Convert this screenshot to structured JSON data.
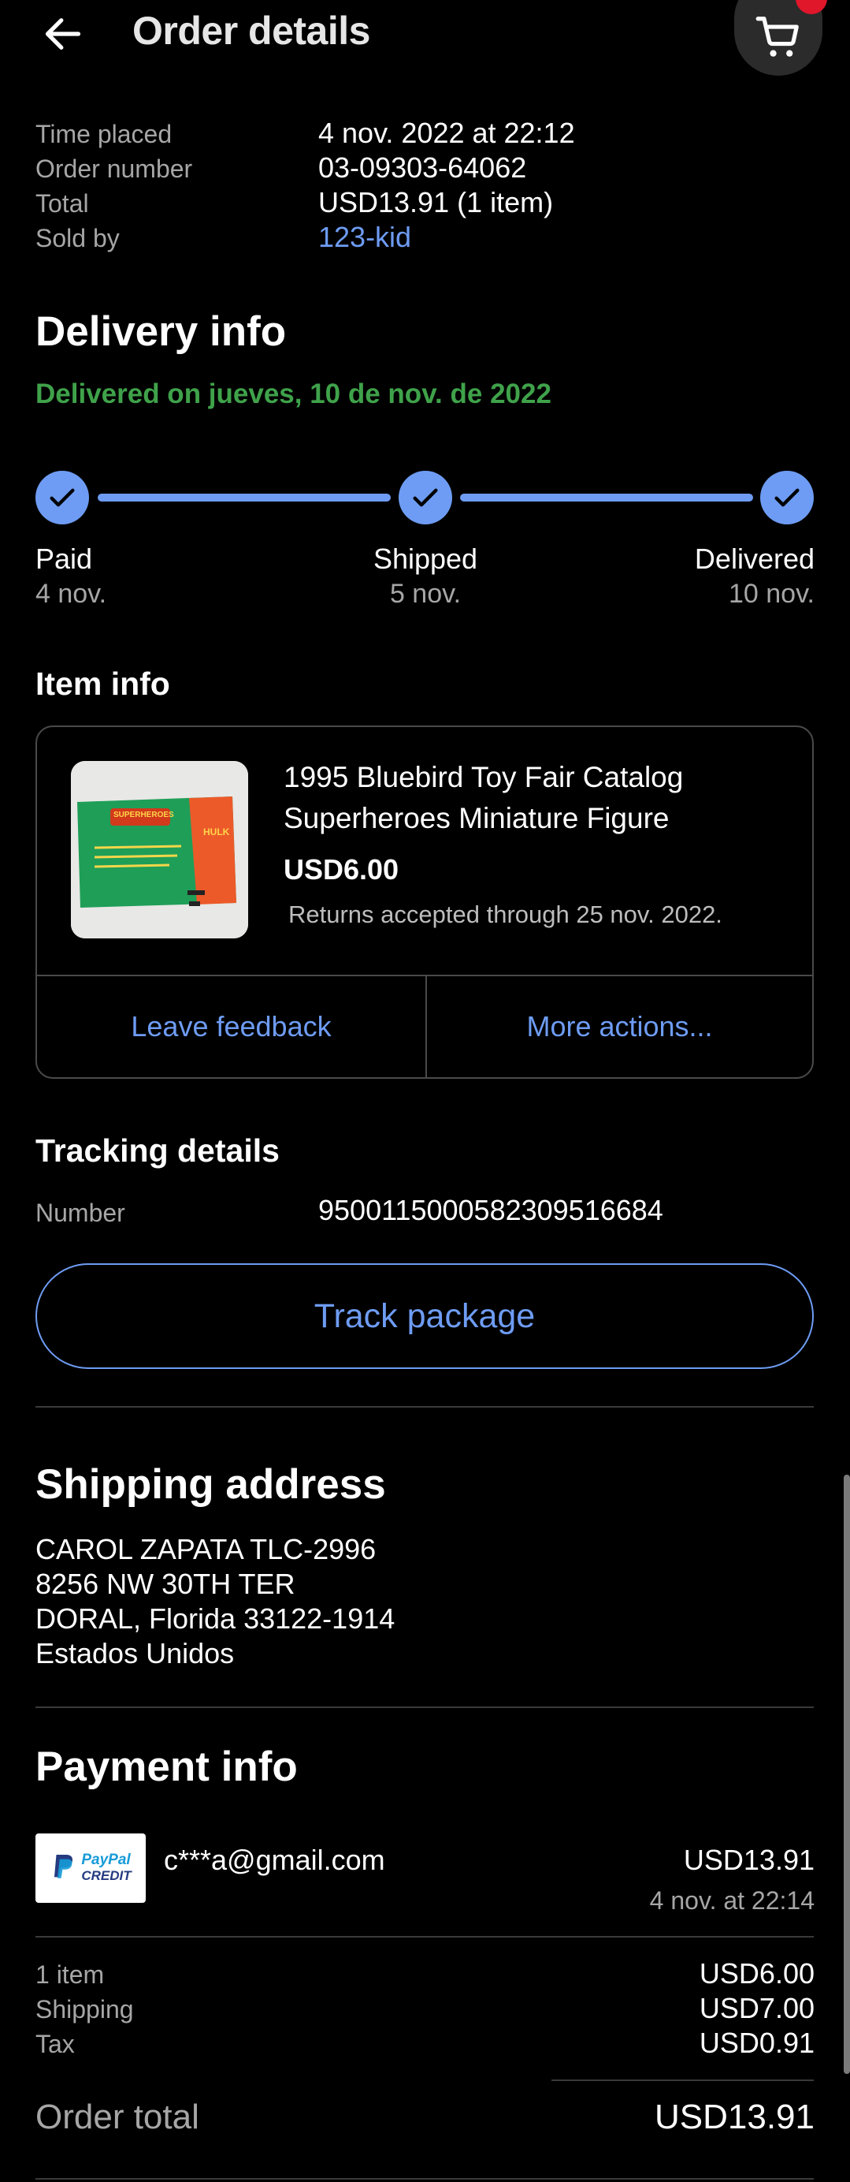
{
  "header": {
    "title": "Order details",
    "back_icon": "arrow-left-icon",
    "cart_icon": "cart-icon"
  },
  "summary": {
    "time_placed_label": "Time placed",
    "time_placed_value": "4 nov. 2022 at 22:12",
    "order_number_label": "Order number",
    "order_number_value": "03-09303-64062",
    "total_label": "Total",
    "total_value": "USD13.91 (1 item)",
    "sold_by_label": "Sold by",
    "sold_by_value": "123-kid"
  },
  "delivery": {
    "title": "Delivery info",
    "status": "Delivered on jueves, 10 de nov. de 2022",
    "steps": [
      {
        "label": "Paid",
        "date": "4 nov."
      },
      {
        "label": "Shipped",
        "date": "5 nov."
      },
      {
        "label": "Delivered",
        "date": "10 nov."
      }
    ]
  },
  "item": {
    "section_title": "Item info",
    "title": "1995 Bluebird Toy Fair Catalog Superheroes Miniature Figure",
    "price": "USD6.00",
    "returns": "Returns accepted through 25 nov. 2022.",
    "thumb_banner": "SUPERHEROES",
    "thumb_tag": "HULK",
    "leave_feedback": "Leave feedback",
    "more_actions": "More actions..."
  },
  "tracking": {
    "title": "Tracking details",
    "number_label": "Number",
    "number_value": "9500115000582309516684",
    "track_button": "Track package"
  },
  "shipping": {
    "title": "Shipping address",
    "lines": [
      "CAROL ZAPATA TLC-2996",
      "8256 NW 30TH TER",
      "DORAL, Florida 33122-1914",
      "Estados Unidos"
    ]
  },
  "payment": {
    "title": "Payment info",
    "method_logo_line1": "PayPal",
    "method_logo_line2": "CREDIT",
    "email": "c***a@gmail.com",
    "amount": "USD13.91",
    "date": "4 nov. at 22:14",
    "items_label": "1 item",
    "items_value": "USD6.00",
    "shipping_label": "Shipping",
    "shipping_value": "USD7.00",
    "tax_label": "Tax",
    "tax_value": "USD0.91",
    "order_total_label": "Order total",
    "order_total_value": "USD13.91"
  },
  "colors": {
    "accent": "#6e9cf4",
    "success": "#3fa24a",
    "badge": "#e0162b",
    "background": "#000000"
  }
}
